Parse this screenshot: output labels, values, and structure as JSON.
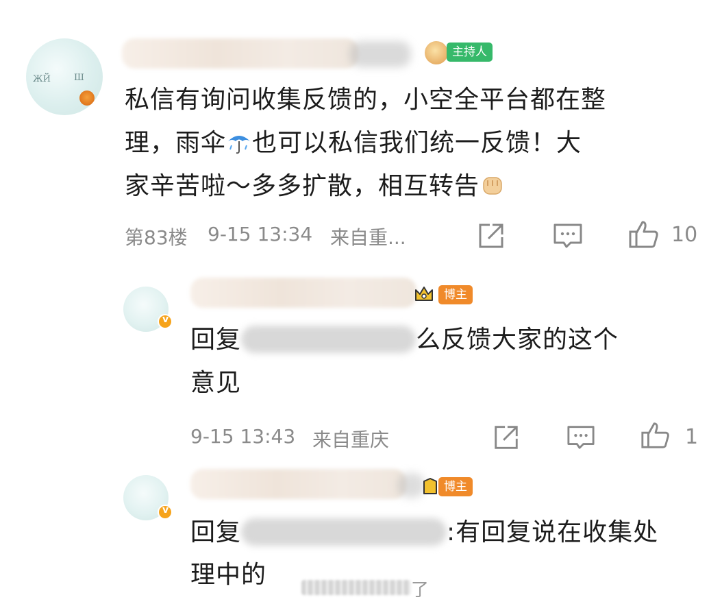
{
  "comment": {
    "host_badge": "主持人",
    "body_line1": "私信有询问收集反馈的，小空全平台都在整",
    "body_line2_a": "理，雨伞",
    "body_line2_b": "也可以私信我们统一反馈！大",
    "body_line3": "家辛苦啦～多多扩散，相互转告",
    "floor": "第83楼",
    "time": "9-15 13:34",
    "location": "来自重...",
    "like_count": "10"
  },
  "replies": [
    {
      "badge": "博主",
      "prefix": "回复",
      "suffix_line1": "么反馈大家的这个",
      "line2": "意见",
      "time": "9-15 13:43",
      "location": "来自重庆",
      "like_count": "1"
    },
    {
      "badge": "博主",
      "prefix": "回复",
      "suffix_line1": ":有回复说在收集处",
      "line2": "理中的",
      "watermark_tail": "了"
    }
  ],
  "icons": {
    "share": "share-icon",
    "comment": "comment-icon",
    "like": "thumbs-up-icon",
    "umbrella": "umbrella-emoji",
    "fist": "fist-emoji",
    "crown": "crown-icon",
    "verified": "verified-v-icon"
  },
  "colors": {
    "host_badge": "#36b96a",
    "blogger_badge": "#f08a2a",
    "meta_text": "#8a8a8a",
    "body_text": "#1c1c1c"
  }
}
